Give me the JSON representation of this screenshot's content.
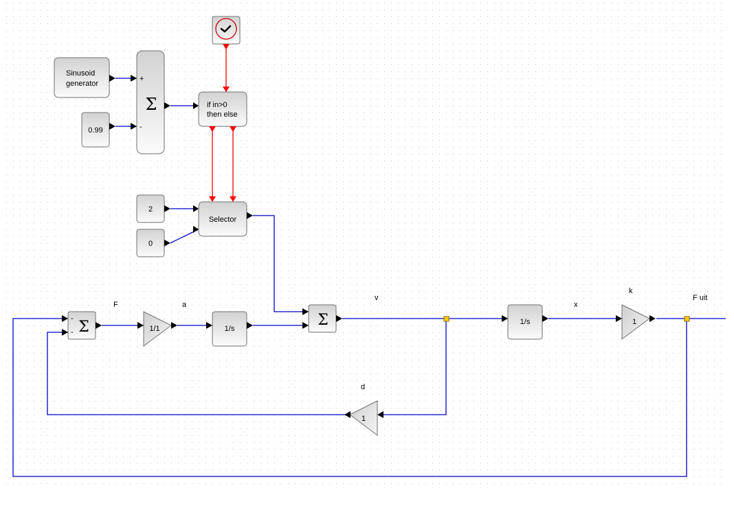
{
  "diagram": {
    "blocks": {
      "sinusoid": {
        "label_line1": "Sinusoid",
        "label_line2": "generator"
      },
      "const_099": {
        "label": "0.99"
      },
      "sum_top": {
        "symbol": "Σ",
        "port1_sign": "+",
        "port2_sign": "-"
      },
      "clock": {
        "icon": "clock-check-icon"
      },
      "if_then_else": {
        "label_line1": "if in>0",
        "label_line2": "then else"
      },
      "const_2": {
        "label": "2"
      },
      "const_0": {
        "label": "0"
      },
      "selector": {
        "label": "Selector"
      },
      "sum_left": {
        "symbol": "Σ",
        "port1_sign": "-",
        "port2_sign": "-"
      },
      "gain_mass": {
        "label": "1/1"
      },
      "integrator_v": {
        "label": "1/s"
      },
      "sum_v": {
        "symbol": "Σ"
      },
      "integrator_x": {
        "label": "1/s"
      },
      "gain_k": {
        "label": "1"
      },
      "gain_d": {
        "label": "1"
      }
    },
    "link_labels": {
      "F": "F",
      "a": "a",
      "v": "v",
      "x": "x",
      "k": "k",
      "F_uit": "F uit",
      "d": "d"
    },
    "colors": {
      "regular_link": "#0000cc",
      "event_link": "#ff0000",
      "split_point": "#ffcc00",
      "block_border": "#707070",
      "grid_dot": "#c0c0c0"
    }
  }
}
